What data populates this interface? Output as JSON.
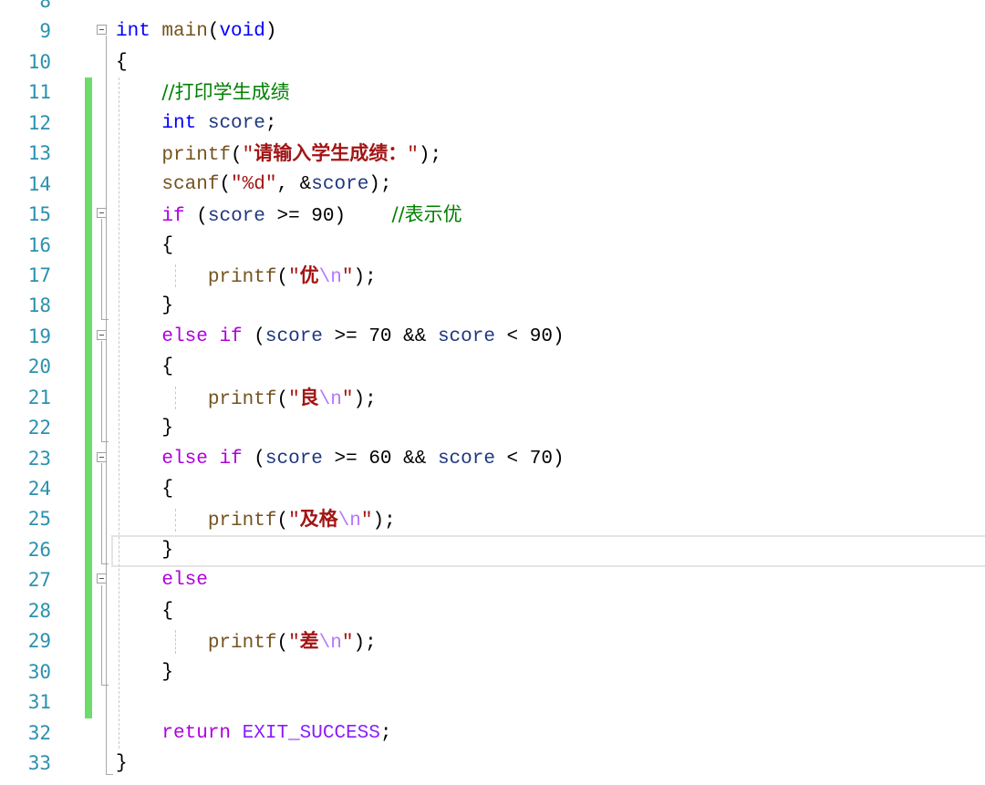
{
  "editor": {
    "language": "c",
    "current_line": 26,
    "colors": {
      "line_number": "#2b91af",
      "change_bar": "#6ddc6d",
      "keyword": "#0000ff",
      "control_keyword": "#af00db",
      "function": "#74531f",
      "string": "#a31515",
      "escape": "#b776fb",
      "variable": "#1f377f",
      "comment": "#008000"
    },
    "lines": [
      {
        "n": "8",
        "text": ""
      },
      {
        "n": "9",
        "text": "int main(void)",
        "fold": true
      },
      {
        "n": "10",
        "text": "{"
      },
      {
        "n": "11",
        "text": "    //打印学生成绩",
        "changed": true
      },
      {
        "n": "12",
        "text": "    int score;",
        "changed": true
      },
      {
        "n": "13",
        "text": "    printf(\"请输入学生成绩：\");",
        "changed": true
      },
      {
        "n": "14",
        "text": "    scanf(\"%d\", &score);",
        "changed": true
      },
      {
        "n": "15",
        "text": "    if (score >= 90)    //表示优",
        "changed": true,
        "fold": true
      },
      {
        "n": "16",
        "text": "    {",
        "changed": true
      },
      {
        "n": "17",
        "text": "        printf(\"优\\n\");",
        "changed": true
      },
      {
        "n": "18",
        "text": "    }",
        "changed": true
      },
      {
        "n": "19",
        "text": "    else if (score >= 70 && score < 90)",
        "changed": true,
        "fold": true
      },
      {
        "n": "20",
        "text": "    {",
        "changed": true
      },
      {
        "n": "21",
        "text": "        printf(\"良\\n\");",
        "changed": true
      },
      {
        "n": "22",
        "text": "    }",
        "changed": true
      },
      {
        "n": "23",
        "text": "    else if (score >= 60 && score < 70)",
        "changed": true,
        "fold": true
      },
      {
        "n": "24",
        "text": "    {",
        "changed": true
      },
      {
        "n": "25",
        "text": "        printf(\"及格\\n\");",
        "changed": true
      },
      {
        "n": "26",
        "text": "    }",
        "changed": true
      },
      {
        "n": "27",
        "text": "    else",
        "changed": true,
        "fold": true
      },
      {
        "n": "28",
        "text": "    {",
        "changed": true
      },
      {
        "n": "29",
        "text": "        printf(\"差\\n\");",
        "changed": true
      },
      {
        "n": "30",
        "text": "    }",
        "changed": true
      },
      {
        "n": "31",
        "text": "",
        "changed": true
      },
      {
        "n": "32",
        "text": "    return EXIT_SUCCESS;"
      },
      {
        "n": "33",
        "text": "}"
      }
    ]
  }
}
